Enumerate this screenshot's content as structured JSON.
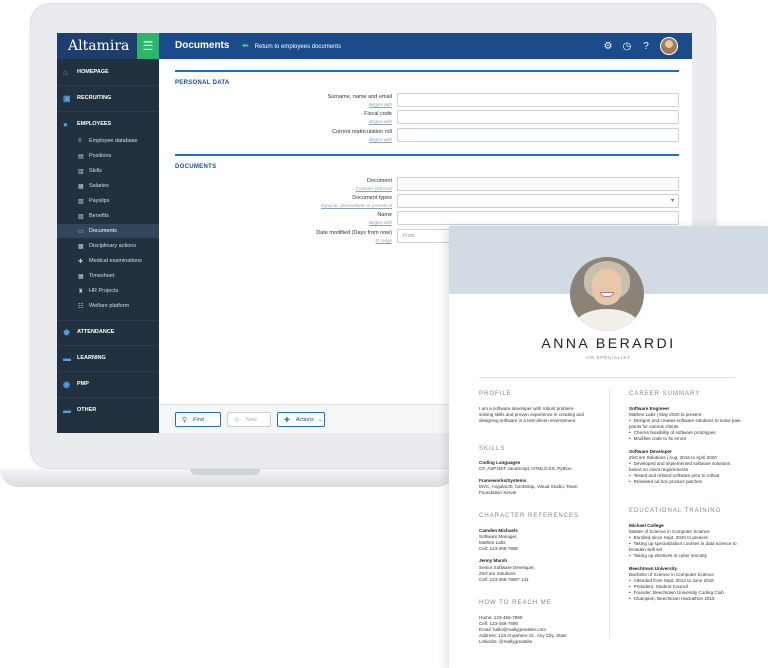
{
  "app": {
    "brand": "Altamira",
    "menu_icon": "hamburger-icon",
    "page_title": "Documents",
    "back_link": "Return to employees documents",
    "header_icons": [
      "gear-icon",
      "clock-icon",
      "help-icon"
    ]
  },
  "sidebar": {
    "sections": [
      {
        "label": "HOMEPAGE",
        "icon": "home-icon"
      },
      {
        "label": "RECRUITING",
        "icon": "briefcase-icon"
      },
      {
        "label": "EMPLOYEES",
        "icon": "users-icon"
      },
      {
        "label": "ATTENDANCE",
        "icon": "attendance-icon"
      },
      {
        "label": "LEARNING",
        "icon": "learning-icon"
      },
      {
        "label": "PMP",
        "icon": "pmp-icon"
      },
      {
        "label": "OTHER",
        "icon": "other-icon"
      }
    ],
    "employee_items": [
      {
        "label": "Employee database",
        "icon": "database-icon"
      },
      {
        "label": "Positions",
        "icon": "positions-icon"
      },
      {
        "label": "Skills",
        "icon": "skills-icon"
      },
      {
        "label": "Salaries",
        "icon": "salaries-icon"
      },
      {
        "label": "Payslips",
        "icon": "payslips-icon"
      },
      {
        "label": "Benefits",
        "icon": "benefits-icon"
      },
      {
        "label": "Documents",
        "icon": "documents-icon",
        "active": true
      },
      {
        "label": "Disciplinary actions",
        "icon": "disciplinary-icon"
      },
      {
        "label": "Medical examinations",
        "icon": "medical-icon"
      },
      {
        "label": "Timesheet",
        "icon": "timesheet-icon"
      },
      {
        "label": "HR Projects",
        "icon": "hr-projects-icon"
      },
      {
        "label": "Welfare platform",
        "icon": "welfare-icon"
      }
    ]
  },
  "form": {
    "personal_data": {
      "title": "PERSONAL DATA",
      "fields": [
        {
          "label": "Surname, name and email",
          "hint": "Begins with",
          "value": ""
        },
        {
          "label": "Fiscal code",
          "hint": "Begins with",
          "value": ""
        },
        {
          "label": "Current matriculation roll",
          "hint": "Begins with",
          "value": ""
        }
      ]
    },
    "documents": {
      "title": "DOCUMENTS",
      "fields": [
        {
          "label": "Document",
          "hint": "Contains (full text)",
          "value": ""
        },
        {
          "label": "Document types",
          "hint": "Equal to, descendants or parents of",
          "value": ""
        },
        {
          "label": "Name",
          "hint": "Begins with",
          "value": ""
        },
        {
          "label": "Date modified (Days from now)",
          "hint": "In range",
          "value": "",
          "placeholder": "From"
        }
      ]
    }
  },
  "toolbar": {
    "find": "Find",
    "new": "New",
    "actions": "Actions"
  },
  "cv": {
    "name": "ANNA BERARDI",
    "role": "HR SPECIALIST",
    "profile_title": "PROFILE",
    "profile_text": "I am a software developer with robust problem-solving skills and proven experience in creating and designing software in a test-driven environment.",
    "skills_title": "SKILLS",
    "skills": [
      {
        "heading": "Coding Languages",
        "text": "C#, ASP.NET JavaScript, HTML/CSS, Python"
      },
      {
        "heading": "Frameworks/Systems",
        "text": "MVC, AngularJS, bootstrap, Visual Studio, Team Foundation Server"
      }
    ],
    "references_title": "CHARACTER REFERENCES",
    "references": [
      {
        "name": "Camden Michaels",
        "line1": "Software Manager,",
        "line2": "Matheo Labs",
        "line3": "Cell: 123-456-7890"
      },
      {
        "name": "Jenny Marsh",
        "line1": "Senior Software Developer,",
        "line2": "ZinCore Solutions",
        "line3": "Cell: 123-456-7890* 141"
      }
    ],
    "contact_title": "HOW TO REACH ME",
    "contact": [
      "Home: 123-456-7890",
      "Cell: 123-456-7890",
      "Email: hello@reallygreatsite.com",
      "Address: 123 Anywhere St., Any City, State",
      "LinkedIn: @reallygreatsite"
    ],
    "career_title": "CAREER SUMMARY",
    "jobs": [
      {
        "title": "Software Engineer",
        "meta": "Matheo Labs | May 2020 to present",
        "bullets": [
          "Designs and creates software solutions to solve pain points for various clients",
          "Checks feasibility of software prototypes",
          "Modifies code to fix errors"
        ]
      },
      {
        "title": "Software Developer",
        "meta": "ZinCore Solutions | Aug. 2016 to April 2020",
        "bullets": [
          "Developed and implemented software solutions based on client requirements",
          "Tested and refined software prior to rollout",
          "Released ad hoc product patches"
        ]
      }
    ],
    "education_title": "EDUCATIONAL TRAINING",
    "schools": [
      {
        "name": "Michael College",
        "meta": "Master of Science in Computer Science",
        "bullets": [
          "Enrolled since Sept. 2020 to present",
          "Taking up specialization courses in data science to broaden skill set",
          "Taking up electives in cyber security"
        ]
      },
      {
        "name": "Beechtown University",
        "meta": "Bachelor of Science in Computer Science",
        "bullets": [
          "Attended from Sept. 2012 to June 2016",
          "President, Student Council",
          "Founder, Beechtown University Coding Club",
          "Champion, Beechtown Hackathon 2015"
        ]
      }
    ]
  }
}
